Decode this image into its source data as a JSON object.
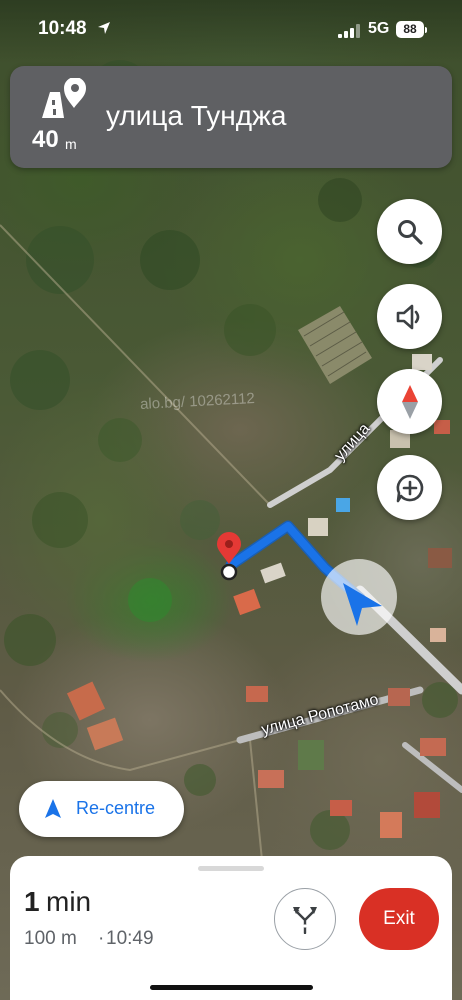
{
  "status_bar": {
    "time": "10:48",
    "network": "5G",
    "battery": "88",
    "icons": [
      "location-arrow-icon",
      "signal-bars-icon"
    ]
  },
  "navigation": {
    "distance_value": "40",
    "distance_unit": "m",
    "street": "улица Тунджа",
    "maneuver_icon": "destination-pin-icon"
  },
  "map": {
    "labels": {
      "road_1": "улица",
      "road_2": "улица Ропотамо",
      "watermark": "alo.bg/ 10262112"
    },
    "route_color": "#1a73e8",
    "destination_color": "#e53935"
  },
  "controls": {
    "buttons": [
      "search-icon",
      "volume-icon",
      "compass-icon",
      "add-report-icon"
    ],
    "recentre_label": "Re-centre"
  },
  "trip": {
    "eta_value": "1",
    "eta_unit": "min",
    "distance": "100 m",
    "separator": "·",
    "arrival_time": "10:49",
    "exit_label": "Exit",
    "exit_color": "#d93025"
  }
}
